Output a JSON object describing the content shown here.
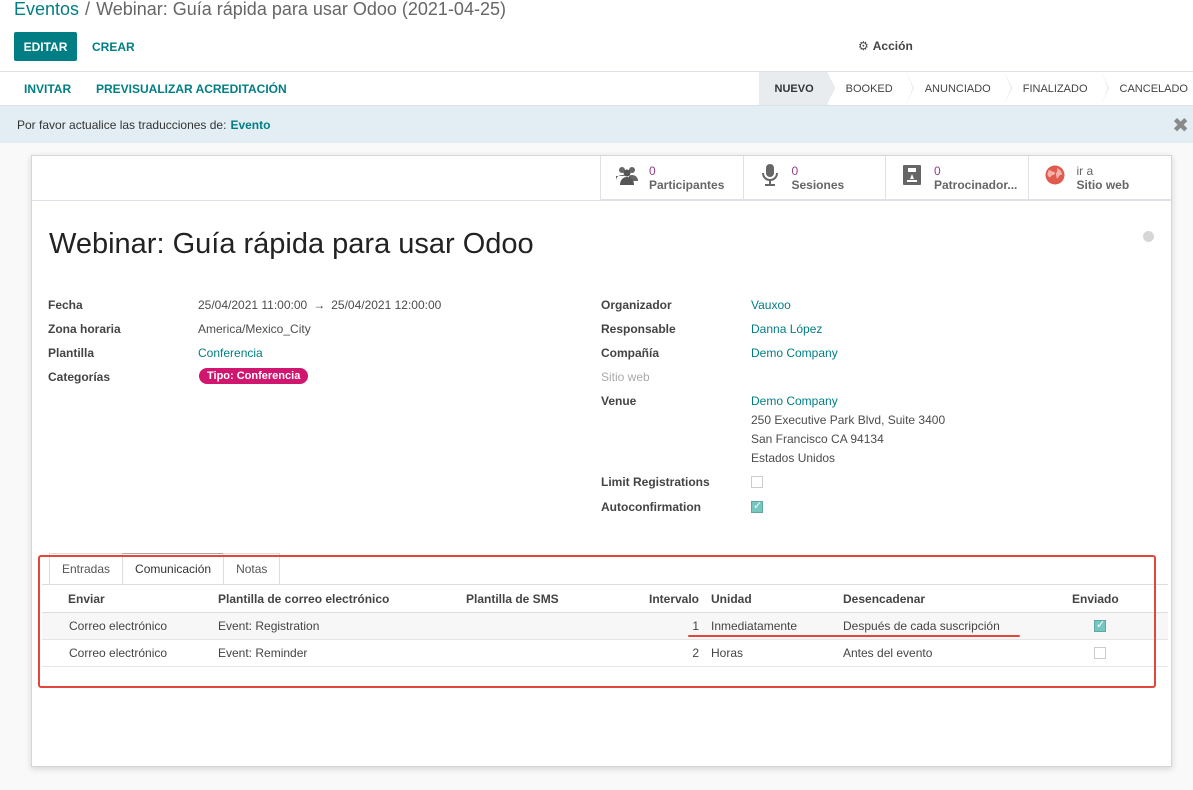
{
  "breadcrumb": {
    "root": "Eventos",
    "separator": "/",
    "current": "Webinar: Guía rápida para usar Odoo (2021-04-25)"
  },
  "toolbar": {
    "edit_label": "EDITAR",
    "create_label": "CREAR",
    "action_label": "Acción",
    "action_icon": "gear-icon"
  },
  "statusbar": {
    "buttons": [
      "INVITAR",
      "PREVISUALIZAR ACREDITACIÓN"
    ],
    "stages": [
      "NUEVO",
      "BOOKED",
      "ANUNCIADO",
      "FINALIZADO",
      "CANCELADO"
    ],
    "active_stage": "NUEVO"
  },
  "alert": {
    "text": "Por favor actualice las traducciones de:",
    "link": "Evento",
    "close_icon": "close-icon"
  },
  "smart_buttons": [
    {
      "icon": "users-icon",
      "value": "0",
      "label": "Participantes"
    },
    {
      "icon": "microphone-icon",
      "value": "0",
      "label": "Sesiones"
    },
    {
      "icon": "sponsor-icon",
      "value": "0",
      "label": "Patrocinador..."
    },
    {
      "icon": "globe-icon",
      "value": "ir a",
      "label": "Sitio web"
    }
  ],
  "event": {
    "title": "Webinar: Guía rápida para usar Odoo",
    "left_fields": {
      "date_label": "Fecha",
      "date_begin": "25/04/2021 11:00:00",
      "date_arrow": "→",
      "date_end": "25/04/2021 12:00:00",
      "tz_label": "Zona horaria",
      "tz_value": "America/Mexico_City",
      "template_label": "Plantilla",
      "template_value": "Conferencia",
      "categories_label": "Categorías",
      "category_tag": "Tipo: Conferencia"
    },
    "right_fields": {
      "organizer_label": "Organizador",
      "organizer_value": "Vauxoo",
      "responsible_label": "Responsable",
      "responsible_value": "Danna López",
      "company_label": "Compañía",
      "company_value": "Demo Company",
      "website_label": "Sitio web",
      "venue_label": "Venue",
      "venue_name": "Demo Company",
      "venue_line1": "250 Executive Park Blvd, Suite 3400",
      "venue_line2": "San Francisco CA 94134",
      "venue_line3": "Estados Unidos",
      "limit_label": "Limit Registrations",
      "limit_checked": false,
      "autoconfirm_label": "Autoconfirmation",
      "autoconfirm_checked": true
    }
  },
  "notebook": {
    "tabs": [
      "Entradas",
      "Comunicación",
      "Notas"
    ],
    "active_tab": "Comunicación",
    "columns": [
      "Enviar",
      "Plantilla de correo electrónico",
      "Plantilla de SMS",
      "Intervalo",
      "Unidad",
      "Desencadenar",
      "Enviado"
    ],
    "rows": [
      {
        "send": "Correo electrónico",
        "mail_template": "Event: Registration",
        "sms_template": "",
        "interval": "1",
        "unit": "Inmediatamente",
        "trigger": "Después de cada suscripción",
        "sent": true
      },
      {
        "send": "Correo electrónico",
        "mail_template": "Event: Reminder",
        "sms_template": "",
        "interval": "2",
        "unit": "Horas",
        "trigger": "Antes del evento",
        "sent": false
      }
    ]
  },
  "colors": {
    "primary": "#017e84",
    "tag": "#d0166f",
    "annotation": "#e2473b",
    "stat_value": "#8f3e82"
  }
}
